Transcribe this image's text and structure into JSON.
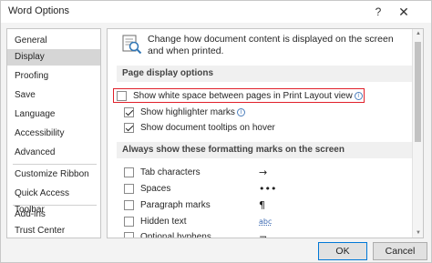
{
  "window": {
    "title": "Word Options",
    "help_glyph": "?",
    "close_glyph": "✕"
  },
  "sidebar": {
    "items": [
      {
        "label": "General",
        "selected": false
      },
      {
        "label": "Display",
        "selected": true
      },
      {
        "label": "Proofing",
        "selected": false
      },
      {
        "label": "Save",
        "selected": false
      },
      {
        "label": "Language",
        "selected": false
      },
      {
        "label": "Accessibility",
        "selected": false
      },
      {
        "label": "Advanced",
        "selected": false
      },
      {
        "label": "Customize Ribbon",
        "selected": false
      },
      {
        "label": "Quick Access Toolbar",
        "selected": false
      },
      {
        "label": "Add-ins",
        "selected": false
      },
      {
        "label": "Trust Center",
        "selected": false
      }
    ]
  },
  "main": {
    "intro": "Change how document content is displayed on the screen and when printed.",
    "page_display": {
      "heading": "Page display options",
      "options": [
        {
          "label": "Show white space between pages in Print Layout view",
          "checked": false,
          "info": "i"
        },
        {
          "label": "Show highlighter marks",
          "checked": true,
          "info": "i"
        },
        {
          "label": "Show document tooltips on hover",
          "checked": true
        }
      ]
    },
    "formatting_marks": {
      "heading": "Always show these formatting marks on the screen",
      "options": [
        {
          "label": "Tab characters",
          "checked": false,
          "symbol": "→"
        },
        {
          "label": "Spaces",
          "checked": false,
          "symbol": "•••"
        },
        {
          "label": "Paragraph marks",
          "checked": false,
          "symbol": "¶"
        },
        {
          "label": "Hidden text",
          "checked": false,
          "symbol": "abc"
        },
        {
          "label": "Optional hyphens",
          "checked": false,
          "symbol": "¬"
        }
      ]
    }
  },
  "buttons": {
    "ok": "OK",
    "cancel": "Cancel"
  },
  "colors": {
    "highlight_border": "#e0202a",
    "ok_border": "#0078d7",
    "selected_bg": "#d6d6d6"
  }
}
